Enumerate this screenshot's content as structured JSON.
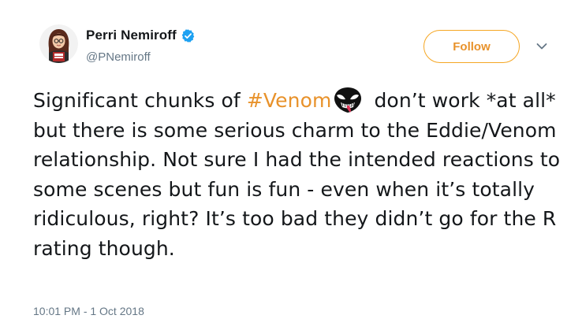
{
  "user": {
    "display_name": "Perri Nemiroff",
    "handle": "@PNemiroff",
    "verified_icon": "verified-badge-icon",
    "verified_color": "#1da1f2"
  },
  "actions": {
    "follow_label": "Follow",
    "accent_color": "#e8922b",
    "more_icon": "chevron-down-icon"
  },
  "tweet": {
    "text_before": "Significant chunks of ",
    "hashtag": "#Venom",
    "emoji": "venom-emoji-icon",
    "text_after": "don’t work *at all* but there is some serious charm to the Eddie/Venom relationship. Not sure I had the intended reactions to some scenes but fun is fun - even when it’s totally ridiculous, right? It’s too bad they didn’t go for the R rating though."
  },
  "meta": {
    "timestamp": "10:01 PM - 1 Oct 2018"
  }
}
